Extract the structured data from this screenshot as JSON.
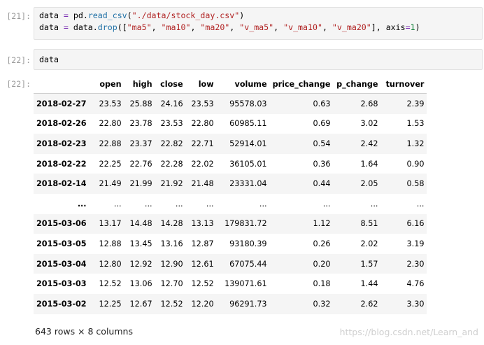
{
  "cells": [
    {
      "prompt": "[21]:",
      "lines": [
        [
          {
            "t": "data",
            "c": "kw"
          },
          {
            "t": " ",
            "c": "kw"
          },
          {
            "t": "=",
            "c": "op"
          },
          {
            "t": " pd.",
            "c": "kw"
          },
          {
            "t": "read_csv",
            "c": "fn"
          },
          {
            "t": "(",
            "c": "kw"
          },
          {
            "t": "\"./data/stock_day.csv\"",
            "c": "str"
          },
          {
            "t": ")",
            "c": "kw"
          }
        ],
        [
          {
            "t": "data",
            "c": "kw"
          },
          {
            "t": " ",
            "c": "kw"
          },
          {
            "t": "=",
            "c": "op"
          },
          {
            "t": " data.",
            "c": "kw"
          },
          {
            "t": "drop",
            "c": "fn"
          },
          {
            "t": "([",
            "c": "kw"
          },
          {
            "t": "\"ma5\"",
            "c": "str"
          },
          {
            "t": ", ",
            "c": "kw"
          },
          {
            "t": "\"ma10\"",
            "c": "str"
          },
          {
            "t": ", ",
            "c": "kw"
          },
          {
            "t": "\"ma20\"",
            "c": "str"
          },
          {
            "t": ", ",
            "c": "kw"
          },
          {
            "t": "\"v_ma5\"",
            "c": "str"
          },
          {
            "t": ", ",
            "c": "kw"
          },
          {
            "t": "\"v_ma10\"",
            "c": "str"
          },
          {
            "t": ", ",
            "c": "kw"
          },
          {
            "t": "\"v_ma20\"",
            "c": "str"
          },
          {
            "t": "], axis",
            "c": "kw"
          },
          {
            "t": "=",
            "c": "op"
          },
          {
            "t": "1",
            "c": "num"
          },
          {
            "t": ")",
            "c": "kw"
          }
        ]
      ]
    },
    {
      "prompt": "[22]:",
      "lines": [
        [
          {
            "t": "data",
            "c": "kw"
          }
        ]
      ]
    }
  ],
  "output_prompt": "[22]:",
  "table": {
    "columns": [
      "open",
      "high",
      "close",
      "low",
      "volume",
      "price_change",
      "p_change",
      "turnover"
    ],
    "rows": [
      {
        "index": "2018-02-27",
        "values": [
          "23.53",
          "25.88",
          "24.16",
          "23.53",
          "95578.03",
          "0.63",
          "2.68",
          "2.39"
        ]
      },
      {
        "index": "2018-02-26",
        "values": [
          "22.80",
          "23.78",
          "23.53",
          "22.80",
          "60985.11",
          "0.69",
          "3.02",
          "1.53"
        ]
      },
      {
        "index": "2018-02-23",
        "values": [
          "22.88",
          "23.37",
          "22.82",
          "22.71",
          "52914.01",
          "0.54",
          "2.42",
          "1.32"
        ]
      },
      {
        "index": "2018-02-22",
        "values": [
          "22.25",
          "22.76",
          "22.28",
          "22.02",
          "36105.01",
          "0.36",
          "1.64",
          "0.90"
        ]
      },
      {
        "index": "2018-02-14",
        "values": [
          "21.49",
          "21.99",
          "21.92",
          "21.48",
          "23331.04",
          "0.44",
          "2.05",
          "0.58"
        ]
      },
      {
        "index": "...",
        "values": [
          "...",
          "...",
          "...",
          "...",
          "...",
          "...",
          "...",
          "..."
        ]
      },
      {
        "index": "2015-03-06",
        "values": [
          "13.17",
          "14.48",
          "14.28",
          "13.13",
          "179831.72",
          "1.12",
          "8.51",
          "6.16"
        ]
      },
      {
        "index": "2015-03-05",
        "values": [
          "12.88",
          "13.45",
          "13.16",
          "12.87",
          "93180.39",
          "0.26",
          "2.02",
          "3.19"
        ]
      },
      {
        "index": "2015-03-04",
        "values": [
          "12.80",
          "12.92",
          "12.90",
          "12.61",
          "67075.44",
          "0.20",
          "1.57",
          "2.30"
        ]
      },
      {
        "index": "2015-03-03",
        "values": [
          "12.52",
          "13.06",
          "12.70",
          "12.52",
          "139071.61",
          "0.18",
          "1.44",
          "4.76"
        ]
      },
      {
        "index": "2015-03-02",
        "values": [
          "12.25",
          "12.67",
          "12.52",
          "12.20",
          "96291.73",
          "0.32",
          "2.62",
          "3.30"
        ]
      }
    ]
  },
  "summary": "643 rows × 8 columns",
  "watermark": "https://blog.csdn.net/Learn_and"
}
